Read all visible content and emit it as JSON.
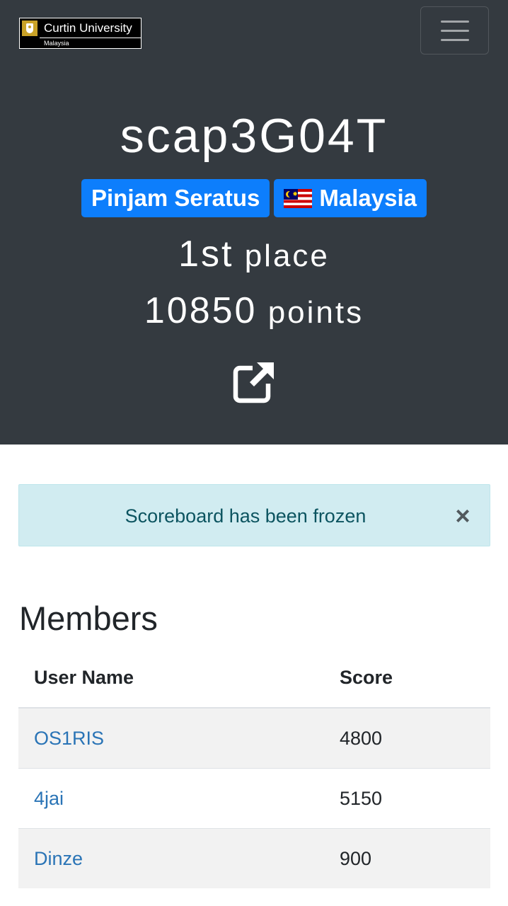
{
  "header": {
    "logo": {
      "name": "Curtin University",
      "subtitle": "Malaysia"
    },
    "menu_icon": "hamburger-menu-icon"
  },
  "team": {
    "name": "scap3G04T",
    "affiliation": "Pinjam Seratus",
    "country": "Malaysia",
    "country_flag_icon": "malaysia-flag-icon",
    "rank_number": "1st",
    "rank_label": "place",
    "points_number": "10850",
    "points_label": "points",
    "website_icon": "external-link-icon"
  },
  "alert": {
    "message": "Scoreboard has been frozen",
    "close_label": "×"
  },
  "members": {
    "title": "Members",
    "columns": [
      "User Name",
      "Score"
    ],
    "rows": [
      {
        "name": "OS1RIS",
        "score": "4800"
      },
      {
        "name": "4jai",
        "score": "5150"
      },
      {
        "name": "Dinze",
        "score": "900"
      }
    ]
  },
  "colors": {
    "hero_background": "#343a40",
    "badge_primary": "#0d7efc",
    "alert_background": "#d1ecf1",
    "alert_text": "#0c5460",
    "link": "#2a74b6",
    "striped_row": "#f2f2f2"
  }
}
